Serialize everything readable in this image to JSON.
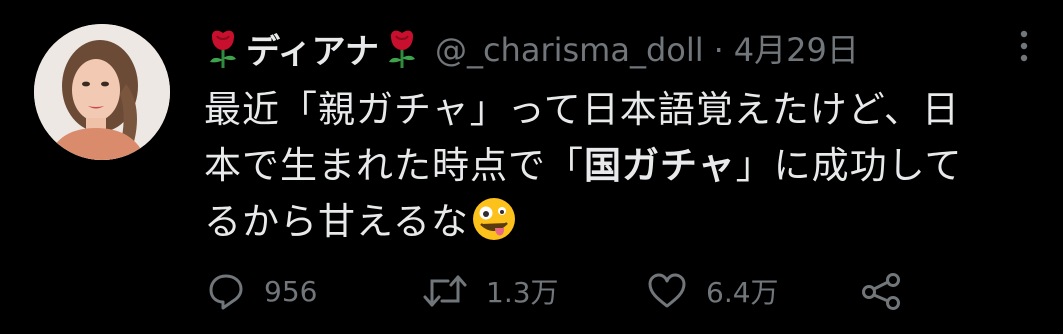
{
  "tweet": {
    "display_name": "ディアナ",
    "handle": "@_charisma_doll",
    "separator": "·",
    "date": "4月29日",
    "text_line1": "最近「親ガチャ」って日本語覚えたけど、日",
    "text_line2_pre": "本で生まれた時点で「",
    "text_line2_bold": "国ガチャ",
    "text_line2_post": "」に成功して",
    "text_line3": "るから甘えるな",
    "emoji_name": "zany-face-emoji",
    "name_decoration_icon": "rose-icon"
  },
  "actions": {
    "reply_count": "956",
    "retweet_count": "1.3万",
    "like_count": "6.4万"
  },
  "colors": {
    "background": "#000000",
    "text": "#e7e9ea",
    "secondary": "#71767b",
    "rose": "#c8102e"
  }
}
